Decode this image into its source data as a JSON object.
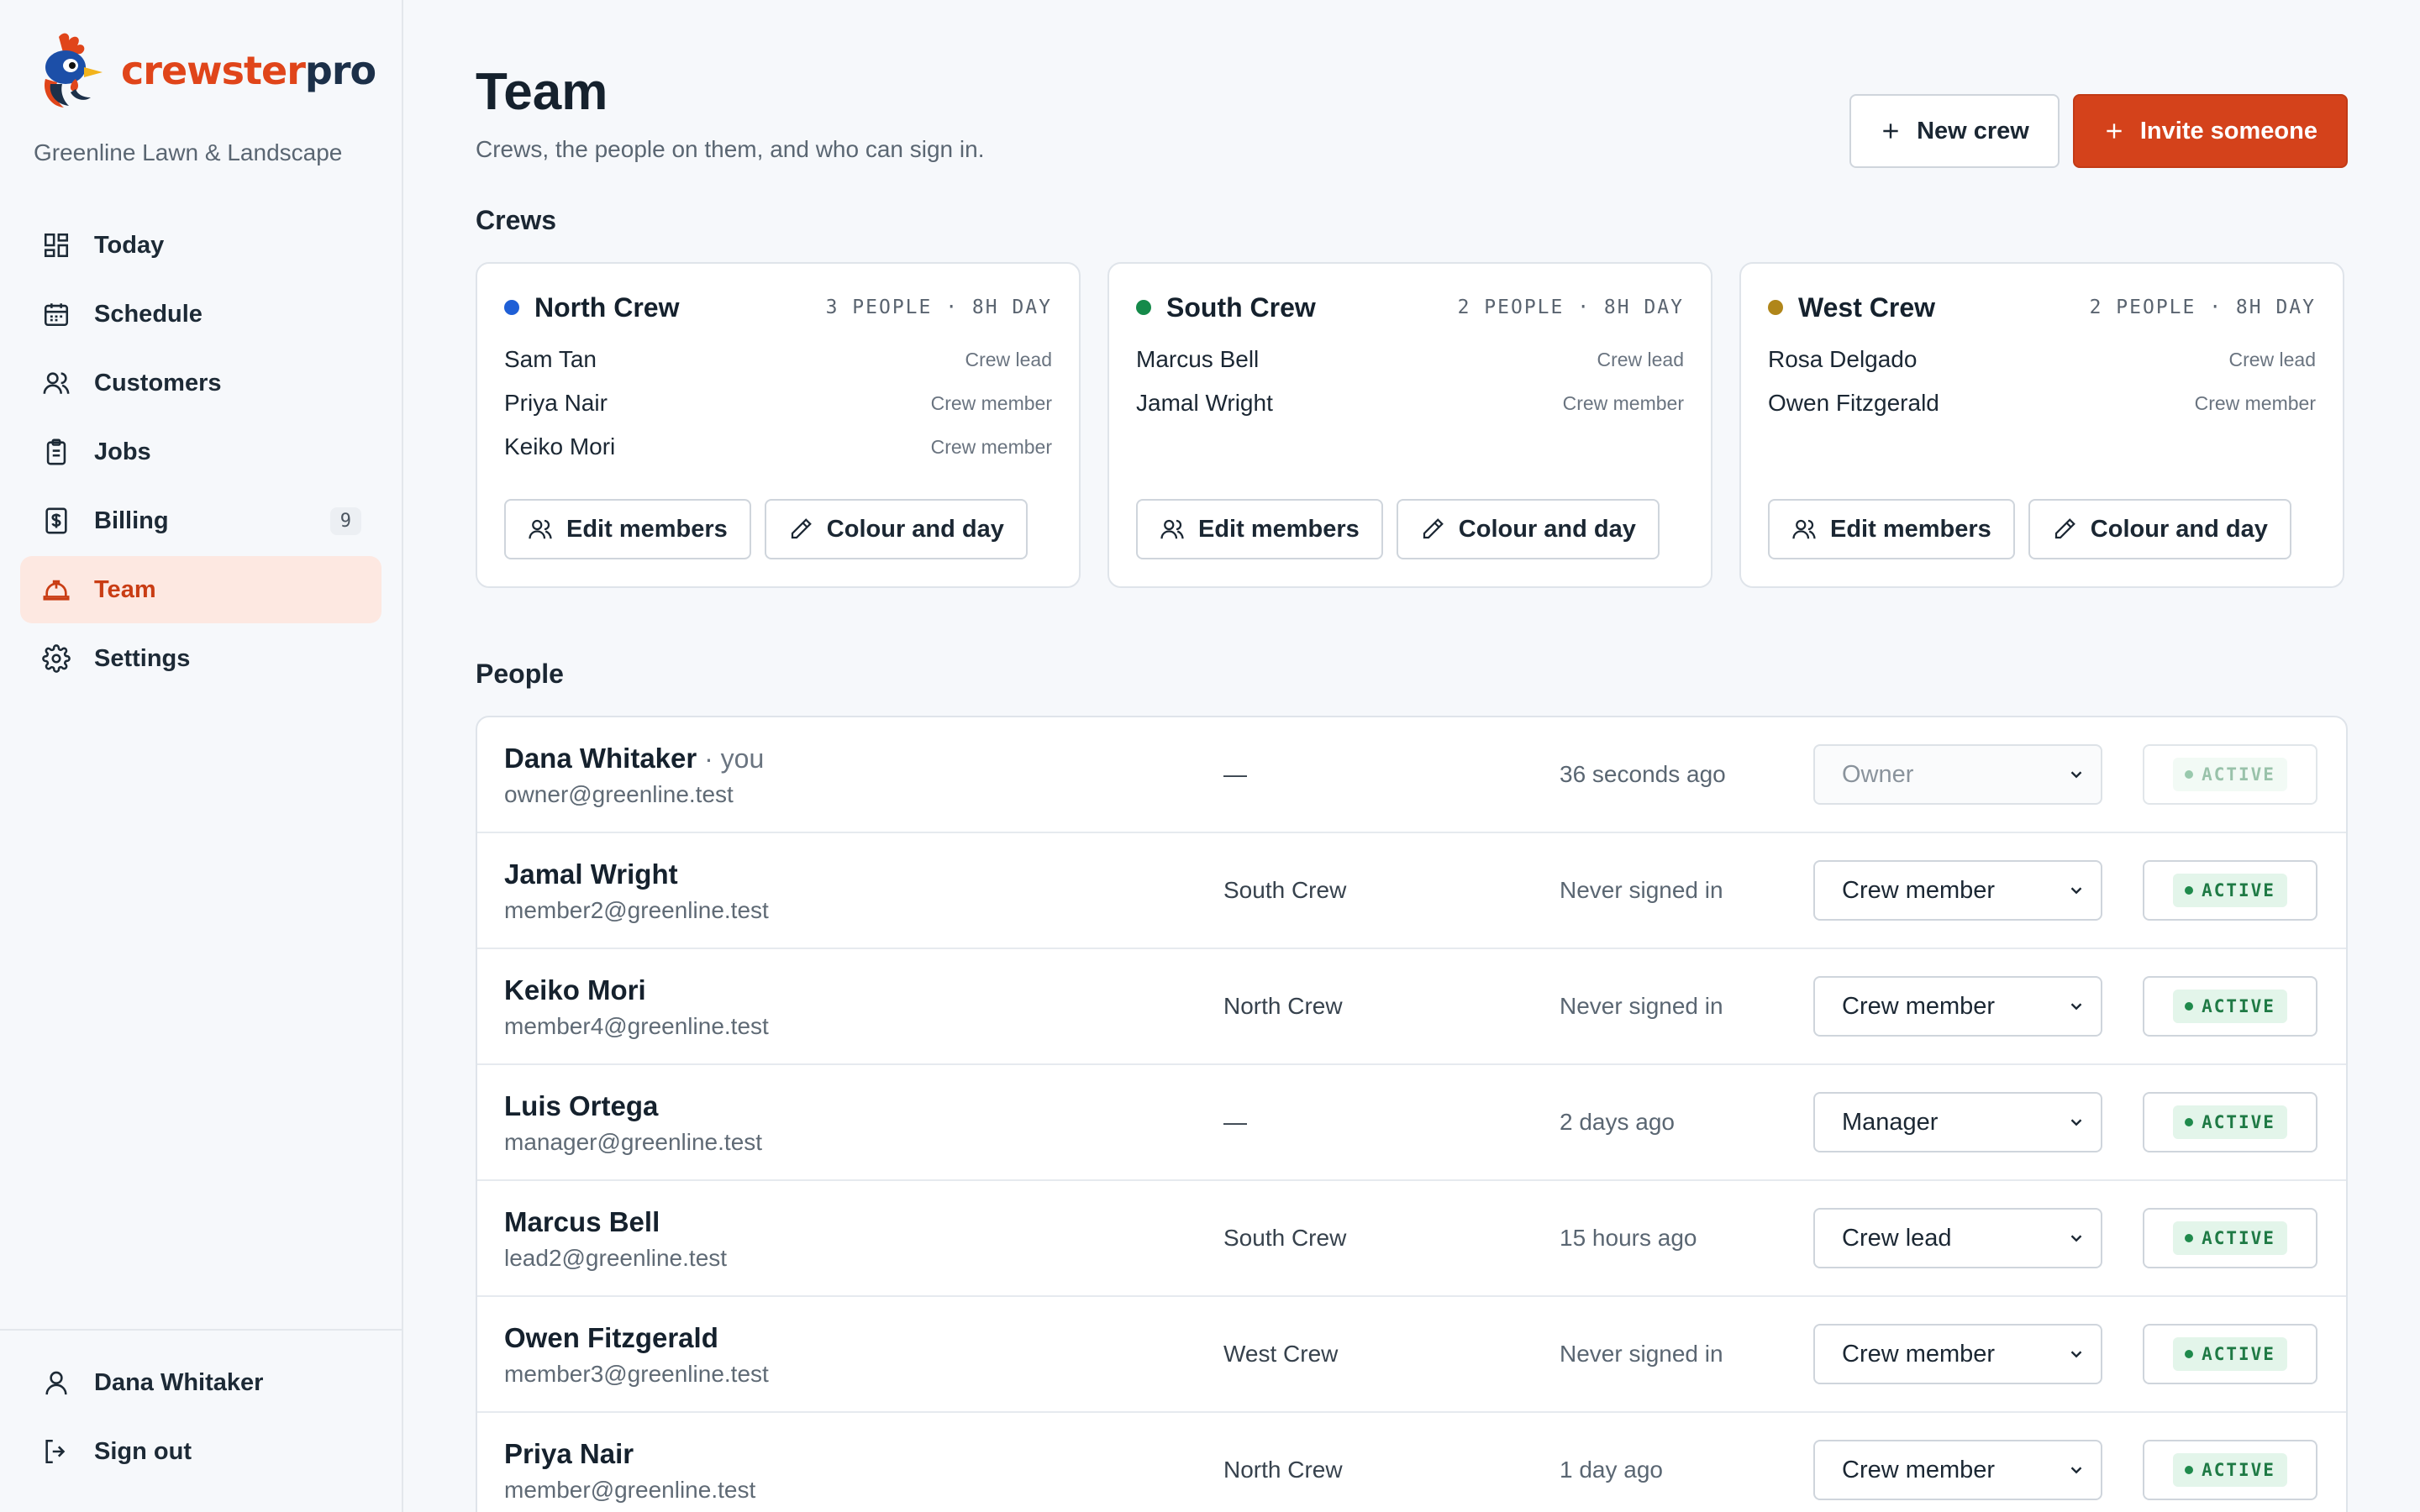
{
  "brand": {
    "name_part1": "crewster",
    "name_part2": "pro",
    "org": "Greenline Lawn & Landscape"
  },
  "nav": {
    "items": [
      {
        "label": "Today",
        "icon": "dashboard-icon"
      },
      {
        "label": "Schedule",
        "icon": "calendar-icon"
      },
      {
        "label": "Customers",
        "icon": "users-icon"
      },
      {
        "label": "Jobs",
        "icon": "clipboard-icon"
      },
      {
        "label": "Billing",
        "icon": "receipt-icon",
        "badge": "9"
      },
      {
        "label": "Team",
        "icon": "hardhat-icon",
        "active": true
      },
      {
        "label": "Settings",
        "icon": "gear-icon"
      }
    ],
    "user": "Dana Whitaker",
    "signout": "Sign out"
  },
  "header": {
    "title": "Team",
    "subtitle": "Crews, the people on them, and who can sign in.",
    "new_crew": "New crew",
    "invite": "Invite someone"
  },
  "crews_section": "Crews",
  "crews": [
    {
      "name": "North Crew",
      "color": "#1f5fd6",
      "meta": "3 PEOPLE · 8H DAY",
      "members": [
        {
          "name": "Sam Tan",
          "role": "Crew lead"
        },
        {
          "name": "Priya Nair",
          "role": "Crew member"
        },
        {
          "name": "Keiko Mori",
          "role": "Crew member"
        }
      ],
      "edit": "Edit members",
      "colour": "Colour and day"
    },
    {
      "name": "South Crew",
      "color": "#158a4a",
      "meta": "2 PEOPLE · 8H DAY",
      "members": [
        {
          "name": "Marcus Bell",
          "role": "Crew lead"
        },
        {
          "name": "Jamal Wright",
          "role": "Crew member"
        },
        {
          "name": "",
          "role": ""
        }
      ],
      "edit": "Edit members",
      "colour": "Colour and day"
    },
    {
      "name": "West Crew",
      "color": "#b0861a",
      "meta": "2 PEOPLE · 8H DAY",
      "members": [
        {
          "name": "Rosa Delgado",
          "role": "Crew lead"
        },
        {
          "name": "Owen Fitzgerald",
          "role": "Crew member"
        },
        {
          "name": "",
          "role": ""
        }
      ],
      "edit": "Edit members",
      "colour": "Colour and day"
    }
  ],
  "people_section": "People",
  "people": [
    {
      "name": "Dana Whitaker",
      "you": " · you",
      "email": "owner@greenline.test",
      "crew": "—",
      "last_seen": "36 seconds ago",
      "role": "Owner",
      "status": "ACTIVE",
      "disabled": true
    },
    {
      "name": "Jamal Wright",
      "you": "",
      "email": "member2@greenline.test",
      "crew": "South Crew",
      "last_seen": "Never signed in",
      "role": "Crew member",
      "status": "ACTIVE"
    },
    {
      "name": "Keiko Mori",
      "you": "",
      "email": "member4@greenline.test",
      "crew": "North Crew",
      "last_seen": "Never signed in",
      "role": "Crew member",
      "status": "ACTIVE"
    },
    {
      "name": "Luis Ortega",
      "you": "",
      "email": "manager@greenline.test",
      "crew": "—",
      "last_seen": "2 days ago",
      "role": "Manager",
      "status": "ACTIVE"
    },
    {
      "name": "Marcus Bell",
      "you": "",
      "email": "lead2@greenline.test",
      "crew": "South Crew",
      "last_seen": "15 hours ago",
      "role": "Crew lead",
      "status": "ACTIVE"
    },
    {
      "name": "Owen Fitzgerald",
      "you": "",
      "email": "member3@greenline.test",
      "crew": "West Crew",
      "last_seen": "Never signed in",
      "role": "Crew member",
      "status": "ACTIVE"
    },
    {
      "name": "Priya Nair",
      "you": "",
      "email": "member@greenline.test",
      "crew": "North Crew",
      "last_seen": "1 day ago",
      "role": "Crew member",
      "status": "ACTIVE"
    }
  ]
}
